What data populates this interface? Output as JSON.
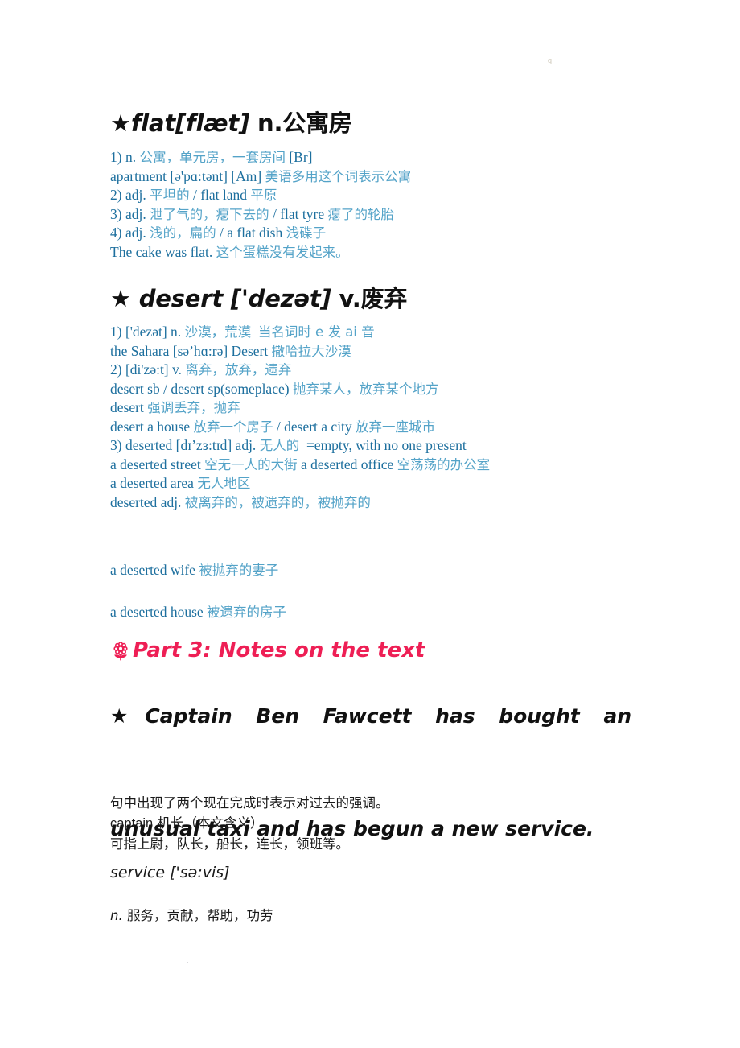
{
  "page": {
    "background": "#ffffff",
    "text_blue_en": "#1d6f9e",
    "text_blue_cn": "#54a3c8",
    "accent_pink": "#ee1f55",
    "text_black": "#1a1a1a",
    "artifact_top": "q",
    "artifact_bottom": "."
  },
  "entry_flat": {
    "heading": {
      "star": "★",
      "word": "flat[flæt]",
      "pos_and_meaning": "n.公寓房"
    },
    "lines": [
      {
        "en": "1) n.",
        "cn": "公寓，单元房，一套房间",
        "tail_en": "[Br]"
      },
      {
        "en": "apartment [ə'pɑ:tənt] [Am]",
        "cn": "美语多用这个词表示公寓",
        "tail_en": ""
      },
      {
        "en": "2) adj.",
        "cn": "平坦的",
        "mid_en": "/ flat land",
        "cn2": "平原"
      },
      {
        "en": "3) adj.",
        "cn": "泄了气的，瘪下去的",
        "mid_en": "/ flat tyre",
        "cn2": "瘪了的轮胎"
      },
      {
        "en": "4) adj.",
        "cn": "浅的，扁的",
        "mid_en": "/ a flat dish",
        "cn2": "浅碟子"
      },
      {
        "en": "The cake was flat.",
        "cn": "这个蛋糕没有发起来。",
        "tail_en": ""
      }
    ]
  },
  "entry_desert": {
    "heading": {
      "star": "★",
      "word": " desert ['dezət]",
      "pos_and_meaning": " v.废弃"
    },
    "lines": [
      {
        "en": "1) ['dezət] n.",
        "cn": "沙漠，荒漠",
        "mid_en": "",
        "cn2": "当名词时 e 发 ai 音"
      },
      {
        "en": "the Sahara [sə’hɑ:rə] Desert",
        "cn": "撒哈拉大沙漠",
        "mid_en": "",
        "cn2": ""
      },
      {
        "en": "2) [di'zə:t] v.",
        "cn": "离弃，放弃，遗弃",
        "mid_en": "",
        "cn2": ""
      },
      {
        "en": "desert sb / desert sp(someplace)",
        "cn": "抛弃某人，放弃某个地方",
        "mid_en": "",
        "cn2": ""
      },
      {
        "en": "desert",
        "cn": "强调丢弃，抛弃",
        "mid_en": "",
        "cn2": ""
      },
      {
        "en": "desert a house",
        "cn": "放弃一个房子",
        "mid_en": "/ desert a city",
        "cn2": "放弃一座城市"
      },
      {
        "en": "3) deserted [dɪ’zɜ:tɪd] adj.",
        "cn": "无人的",
        "mid_en": "=empty, with no one present",
        "cn2": ""
      },
      {
        "en": "a deserted street",
        "cn": "空无一人的大街",
        "mid_en": "a deserted office",
        "cn2": "空荡荡的办公室"
      },
      {
        "en": "a deserted area",
        "cn": "无人地区",
        "mid_en": "",
        "cn2": ""
      },
      {
        "en": "deserted adj.",
        "cn": "被离弃的，被遗弃的，被抛弃的",
        "mid_en": "",
        "cn2": ""
      }
    ],
    "spaced_lines": [
      {
        "en": "a deserted wife",
        "cn": "被抛弃的妻子"
      },
      {
        "en": "a deserted house",
        "cn": "被遗弃的房子"
      }
    ]
  },
  "part3": {
    "icon": "flower-icon",
    "title": "Part 3: Notes on the text"
  },
  "sentence": {
    "star": "★",
    "line1": "Captain Ben Fawcett has bought an",
    "line2": "unusual taxi and has begun a new service."
  },
  "notes": {
    "line1": "句中出现了两个现在完成时表示对过去的强调。",
    "line2_word": "captain",
    "line2_cn": "机长（本文含义）",
    "line3": "可指上尉，队长，船长，连长，领班等。",
    "service_head": "service ['sə:vis]",
    "service_def_pos": "n.",
    "service_def_cn": "服务，贡献，帮助，功劳"
  }
}
